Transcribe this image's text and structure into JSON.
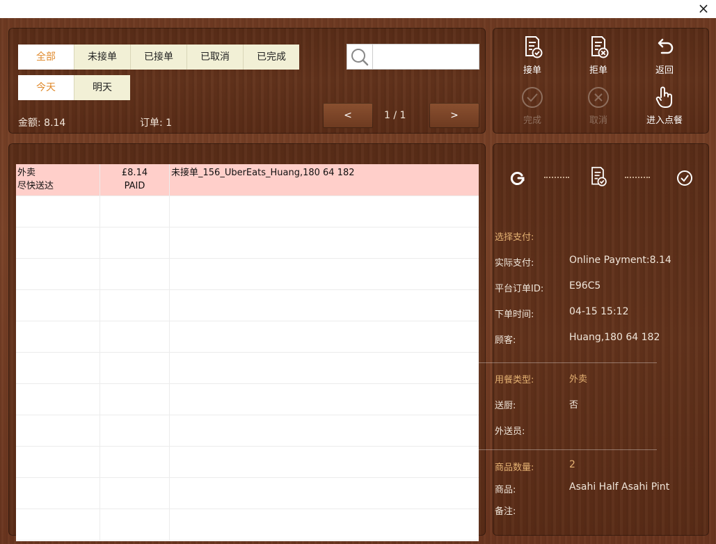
{
  "window": {
    "close_label": "×"
  },
  "filters": {
    "status_tabs": [
      "全部",
      "未接单",
      "已接单",
      "已取消",
      "已完成"
    ],
    "date_tabs": [
      "今天",
      "明天"
    ]
  },
  "search": {
    "value": "",
    "placeholder": ""
  },
  "summary": {
    "amount": "金额: 8.14",
    "orders": "订单: 1"
  },
  "pager": {
    "prev": "<",
    "indicator": "1 / 1",
    "next": ">"
  },
  "actions": {
    "accept": "接单",
    "reject": "拒单",
    "back": "返回",
    "complete": "完成",
    "cancel": "取消",
    "enter_order": "进入点餐"
  },
  "orders": [
    {
      "type": "外卖",
      "delivery": "尽快送达",
      "amount": "£8.14",
      "pay_status": "PAID",
      "description": "未接单_156_UberEats_Huang,180 64 182"
    }
  ],
  "details": {
    "payment_select_label": "选择支付:",
    "actual_payment_label": "实际支付:",
    "actual_payment_value": "Online Payment:8.14",
    "platform_order_label": "平台订单ID:",
    "platform_order_value": "E96C5",
    "order_time_label": "下单时间:",
    "order_time_value": "04-15 15:12",
    "customer_label": "顾客:",
    "customer_value": "Huang,180 64 182",
    "dining_type_label": "用餐类型:",
    "dining_type_value": "外卖",
    "kitchen_label": "送厨:",
    "kitchen_value": "否",
    "courier_label": "外送员:",
    "item_count_label": "商品数量:",
    "item_count_value": "2",
    "items_label": "商品:",
    "items_value": "Asahi Half Asahi Pint",
    "notes_label": "备注:"
  },
  "colors": {
    "accent": "#e08a2c",
    "highlight_row": "#ffcfca",
    "detail_accent": "#e5b273"
  }
}
